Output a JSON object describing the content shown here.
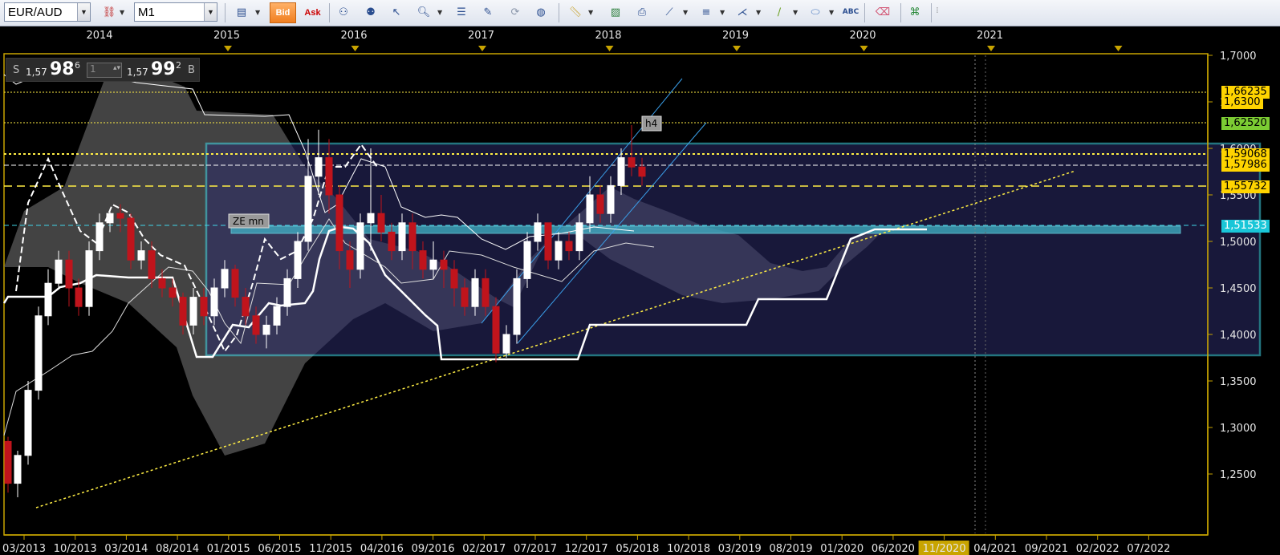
{
  "toolbar": {
    "symbol": "EUR/AUD",
    "timeframe": "M1",
    "bid_label": "Bid",
    "ask_label": "Ask",
    "icons": [
      "crosshair-icon",
      "chart-type-icon",
      "indicators-icon",
      "zoom-icon",
      "fibonacci-icon",
      "template-icon",
      "refresh-icon",
      "globe-icon",
      "ruler-icon",
      "image-icon",
      "print-icon",
      "trendline-icon",
      "channel-icon",
      "pitchfork-icon",
      "line-icon",
      "ellipse-icon",
      "text-icon",
      "eraser-icon",
      "tree-icon"
    ]
  },
  "price_panel": {
    "sell_label": "S",
    "sell_prefix": "1,57",
    "sell_big": "98",
    "sell_sup": "6",
    "quantity": "1",
    "buy_prefix": "1,57",
    "buy_big": "99",
    "buy_sup": "2",
    "buy_label": "B"
  },
  "chart_data": {
    "type": "candlestick",
    "title": "",
    "ylim": [
      1.2,
      1.7
    ],
    "y_ticks": [
      "1,7000",
      "1,6500",
      "1,6000",
      "1,5500",
      "1,5000",
      "1,4500",
      "1,4000",
      "1,3500",
      "1,3000",
      "1,2500"
    ],
    "x_ticks": [
      "03/2013",
      "10/2013",
      "03/2014",
      "08/2014",
      "01/2015",
      "06/2015",
      "11/2015",
      "04/2016",
      "09/2016",
      "02/2017",
      "07/2017",
      "12/2017",
      "05/2018",
      "10/2018",
      "03/2019",
      "08/2019",
      "01/2020",
      "06/2020",
      "11/2020",
      "04/2021",
      "09/2021",
      "02/2022",
      "07/2022"
    ],
    "highlighted_x_tick": "11/2020",
    "year_labels": [
      "2014",
      "2015",
      "2016",
      "2017",
      "2018",
      "2019",
      "2020",
      "2021"
    ],
    "price_labels": [
      {
        "text": "1,66235",
        "bg": "#ffd400",
        "fg": "#000000"
      },
      {
        "text": "1,6300",
        "bg": "#ffd400",
        "fg": "#000000"
      },
      {
        "text": "1,62520",
        "bg": "#7ccc33",
        "fg": "#000000"
      },
      {
        "text": "1,59068",
        "bg": "#ffd400",
        "fg": "#000000"
      },
      {
        "text": "1,57986",
        "bg": "#ffd400",
        "fg": "#000000"
      },
      {
        "text": "1,55732",
        "bg": "#ffd400",
        "fg": "#000000"
      },
      {
        "text": "1,51533",
        "bg": "#19c6d8",
        "fg": "#ffffff"
      }
    ],
    "annotations": [
      "ZE mn",
      "h4"
    ],
    "colors": {
      "bull": "#ffffff",
      "bear": "#c0141c",
      "background": "#000000",
      "axis": "#c8a400",
      "support": "#41d6e8",
      "trend": "#ffee44"
    }
  }
}
